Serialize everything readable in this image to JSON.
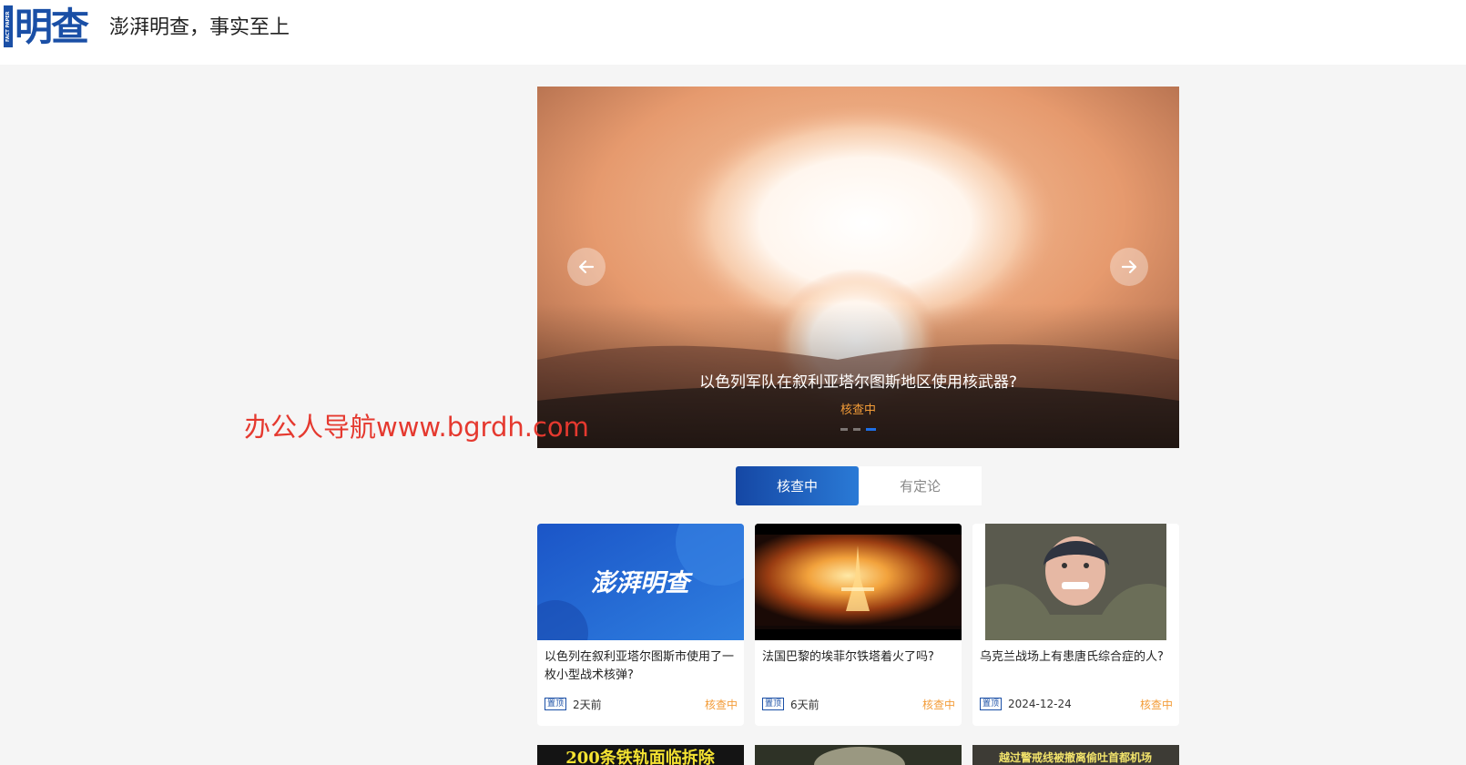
{
  "header": {
    "logo_vertical": "FACT PAPER",
    "logo_text": "明查",
    "slogan": "澎湃明查，事实至上"
  },
  "hero": {
    "caption": "以色列军队在叙利亚塔尔图斯地区使用核武器?",
    "status": "核查中",
    "slide_count": 3,
    "active_slide": 3
  },
  "watermark": "办公人导航www.bgrdh.com",
  "tabs": [
    "核查中",
    "有定论"
  ],
  "cards": [
    {
      "thumb_text": "澎湃明查",
      "title": "以色列在叙利亚塔尔图斯市使用了一枚小型战术核弹?",
      "tag": "置顶",
      "time": "2天前",
      "status": "核查中"
    },
    {
      "title": "法国巴黎的埃菲尔铁塔着火了吗?",
      "tag": "置顶",
      "time": "6天前",
      "status": "核查中"
    },
    {
      "title": "乌克兰战场上有患唐氏综合症的人?",
      "tag": "置顶",
      "time": "2024-12-24",
      "status": "核查中"
    }
  ],
  "row2": [
    {
      "thumb_text": "200条铁轨面临拆除"
    },
    {},
    {
      "thumb_text": "越过警戒线被撤离偷吐首都机场"
    }
  ],
  "colors": {
    "brand": "#1a4fa6",
    "status": "#f39c38",
    "watermark": "#e5392f"
  }
}
